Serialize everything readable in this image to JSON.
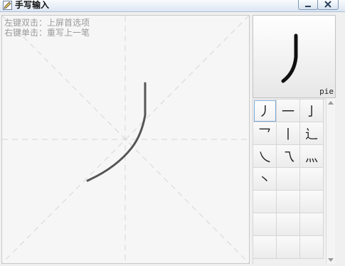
{
  "window": {
    "title": "手写输入",
    "icon": "pencil-icon"
  },
  "canvas": {
    "hint_line1": "左键双击：上屏首选项",
    "hint_line2": "右键单击：重写上一笔"
  },
  "preview": {
    "character": "丿",
    "pinyin": "pie"
  },
  "candidates": [
    "丿",
    "一",
    "亅",
    "乛",
    "丨",
    "辶",
    "乀",
    "乁",
    "灬",
    "丶",
    "",
    "",
    "",
    "",
    "",
    "",
    "",
    "",
    "",
    "",
    "",
    ""
  ],
  "colors": {
    "title_bar": "#dbe6f3",
    "stroke": "#555555",
    "selected_border": "#7aa7d6"
  }
}
